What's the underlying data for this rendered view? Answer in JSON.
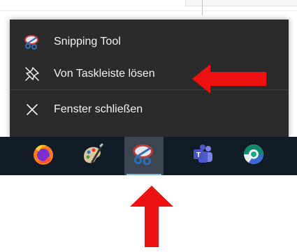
{
  "jumplist": {
    "items": [
      {
        "label": "Snipping Tool",
        "icon": "snipping-tool-icon"
      },
      {
        "label": "Von Taskleiste lösen",
        "icon": "unpin-icon"
      },
      {
        "label": "Fenster schließen",
        "icon": "close-icon"
      }
    ]
  },
  "taskbar": {
    "apps": [
      {
        "icon": "firefox-icon"
      },
      {
        "icon": "paint-icon"
      },
      {
        "icon": "snipping-tool-icon",
        "active": true
      },
      {
        "icon": "teams-icon"
      },
      {
        "icon": "browser-icon"
      }
    ]
  },
  "annotations": {
    "arrow_color": "#ee1111"
  },
  "colors": {
    "menu_bg": "#2b2b2b",
    "taskbar_bg": "#121c27",
    "active_tile": "#3d4650",
    "indicator": "#7fb3e6"
  }
}
